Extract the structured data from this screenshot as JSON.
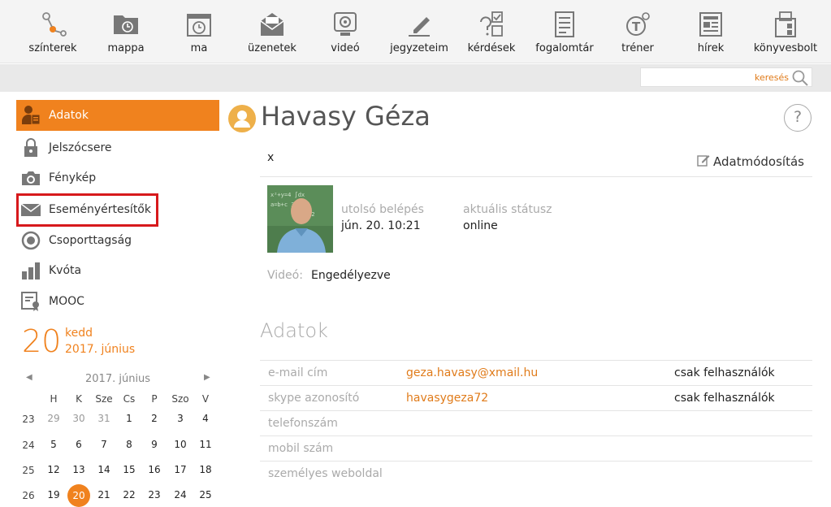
{
  "toolbar": {
    "items": [
      {
        "label": "színterek",
        "icon": "network-icon"
      },
      {
        "label": "mappa",
        "icon": "folder-icon"
      },
      {
        "label": "ma",
        "icon": "calendar-clock-icon"
      },
      {
        "label": "üzenetek",
        "icon": "envelope-icon"
      },
      {
        "label": "videó",
        "icon": "webcam-icon"
      },
      {
        "label": "jegyzeteim",
        "icon": "pencil-icon"
      },
      {
        "label": "kérdések",
        "icon": "quiz-icon"
      },
      {
        "label": "fogalomtár",
        "icon": "glossary-icon"
      },
      {
        "label": "tréner",
        "icon": "trainer-icon"
      },
      {
        "label": "hírek",
        "icon": "newspaper-icon"
      },
      {
        "label": "könyvesbolt",
        "icon": "bookstore-icon"
      }
    ]
  },
  "search": {
    "placeholder": "keresés"
  },
  "sidebar": {
    "items": [
      {
        "label": "Adatok",
        "icon": "profile-icon",
        "active": true
      },
      {
        "label": "Jelszócsere",
        "icon": "lock-icon"
      },
      {
        "label": "Fénykép",
        "icon": "camera-icon"
      },
      {
        "label": "Eseményértesítők",
        "icon": "mail-icon"
      },
      {
        "label": "Csoporttagság",
        "icon": "group-circle-icon"
      },
      {
        "label": "Kvóta",
        "icon": "bar-chart-icon"
      },
      {
        "label": "MOOC",
        "icon": "certificate-icon"
      }
    ]
  },
  "date": {
    "day": "20",
    "weekday": "kedd",
    "month": "2017. június"
  },
  "calendar": {
    "title": "2017. június",
    "headers": [
      "H",
      "K",
      "Sze",
      "Cs",
      "P",
      "Szo",
      "V"
    ],
    "weeks": [
      {
        "wk": "23",
        "days": [
          "29",
          "30",
          "31",
          "1",
          "2",
          "3",
          "4"
        ]
      },
      {
        "wk": "24",
        "days": [
          "5",
          "6",
          "7",
          "8",
          "9",
          "10",
          "11"
        ]
      },
      {
        "wk": "25",
        "days": [
          "12",
          "13",
          "14",
          "15",
          "16",
          "17",
          "18"
        ]
      },
      {
        "wk": "26",
        "days": [
          "19",
          "20",
          "21",
          "22",
          "23",
          "24",
          "25"
        ]
      }
    ]
  },
  "profile": {
    "name": "Havasy Géza",
    "x": "x",
    "edit_label": "Adatmódosítás",
    "last_login_label": "utolsó belépés",
    "last_login": "jún. 20. 10:21",
    "status_label": "aktuális státusz",
    "status": "online",
    "video_label": "Videó:",
    "video_value": "Engedélyezve"
  },
  "details": {
    "title": "Adatok",
    "rows": [
      {
        "label": "e-mail cím",
        "value": "geza.havasy@xmail.hu",
        "visibility": "csak felhasználók"
      },
      {
        "label": "skype azonosító",
        "value": "havasygeza72",
        "visibility": "csak felhasználók"
      },
      {
        "label": "telefonszám",
        "value": "",
        "visibility": ""
      },
      {
        "label": "mobil szám",
        "value": "",
        "visibility": ""
      },
      {
        "label": "személyes weboldal",
        "value": "",
        "visibility": ""
      }
    ]
  },
  "colors": {
    "accent": "#f0821e",
    "highlight_border": "#d7191c"
  }
}
